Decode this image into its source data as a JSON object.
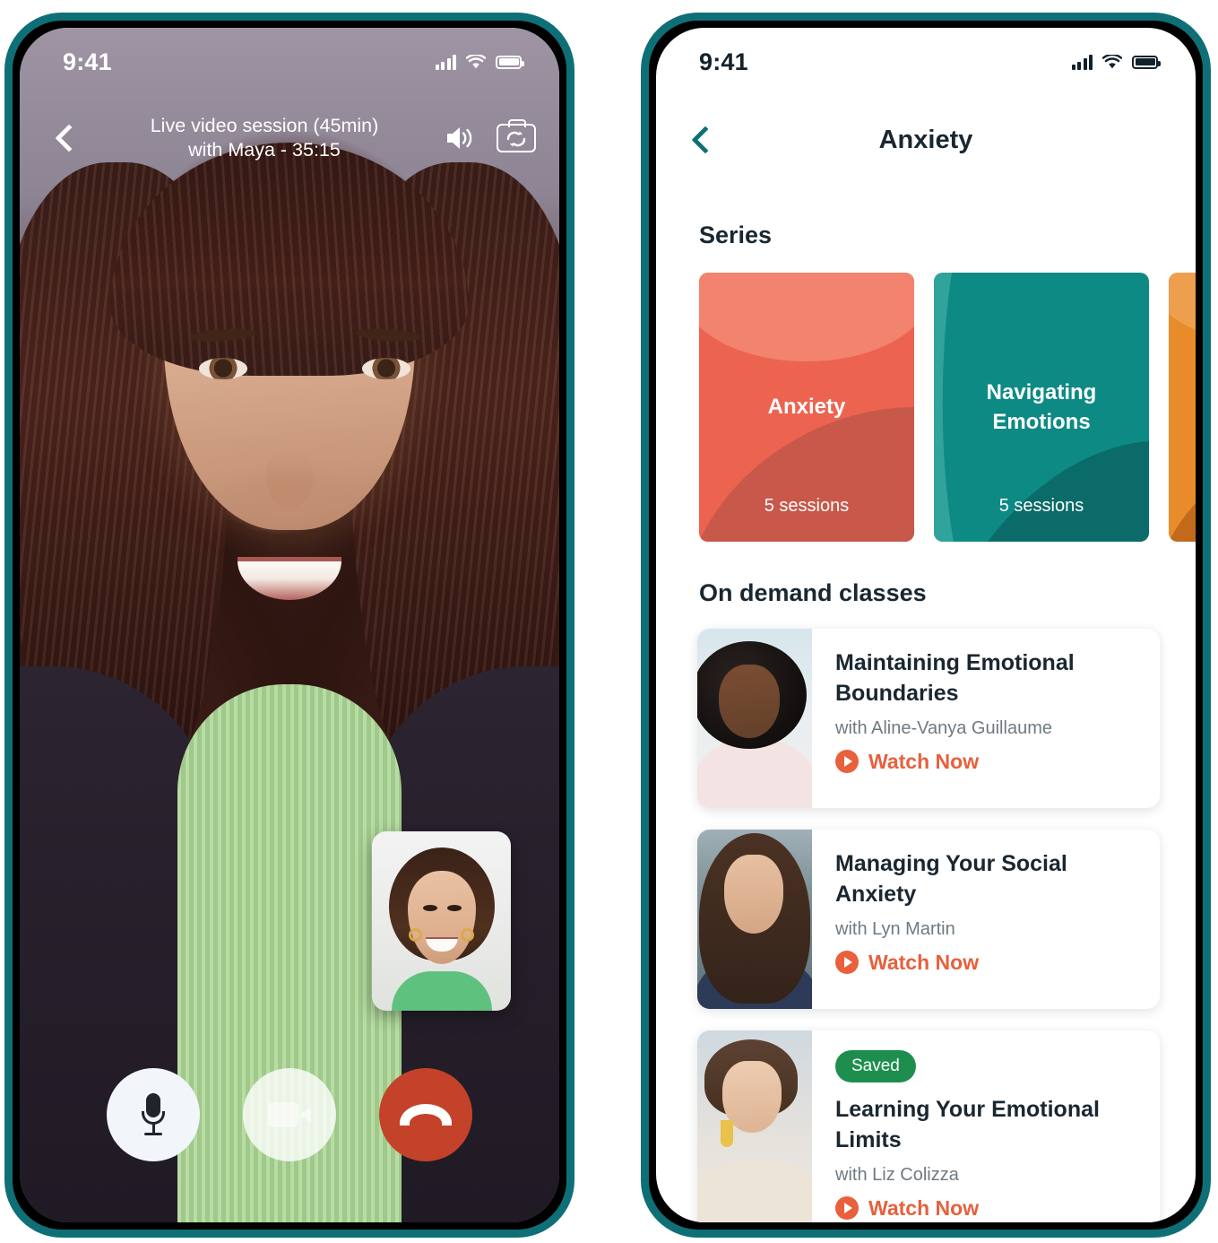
{
  "theme": {
    "frame_teal": "#0E7076",
    "coral": "#EC6450",
    "teal": "#0E8A84",
    "orange": "#E88B2A",
    "watch_orange": "#E8603C",
    "saved_green": "#1E8E4E",
    "end_call_red": "#C4422A",
    "text_dark": "#1A2730",
    "text_muted": "#6D7A82"
  },
  "left_phone": {
    "status_bar": {
      "time": "9:41",
      "icons": [
        "signal-icon",
        "wifi-icon",
        "battery-icon"
      ]
    },
    "header": {
      "back_icon": "chevron-left-icon",
      "title_line1": "Live video session (45min)",
      "title_line2": "with Maya - 35:15",
      "speaker_icon": "speaker-on-icon",
      "flip_camera_icon": "flip-camera-icon"
    },
    "pip": {
      "label": "self-view-thumbnail"
    },
    "controls": [
      {
        "name": "microphone-button",
        "icon": "microphone-icon"
      },
      {
        "name": "camera-button",
        "icon": "video-camera-icon"
      },
      {
        "name": "end-call-button",
        "icon": "phone-hangup-icon"
      }
    ]
  },
  "right_phone": {
    "status_bar": {
      "time": "9:41",
      "icons": [
        "signal-icon",
        "wifi-icon",
        "battery-icon"
      ]
    },
    "nav": {
      "back_icon": "chevron-left-icon",
      "title": "Anxiety"
    },
    "sections": {
      "series_title": "Series",
      "on_demand_title": "On demand classes"
    },
    "series": [
      {
        "name": "Anxiety",
        "sessions": "5 sessions",
        "color": "#EC6450"
      },
      {
        "name": "Navigating Emotions",
        "sessions": "5 sessions",
        "color": "#0E8A84"
      },
      {
        "name": "",
        "sessions": "",
        "color": "#E88B2A"
      }
    ],
    "classes": [
      {
        "badge": null,
        "title": "Maintaining Emotional Boundaries",
        "author": "with Aline-Vanya Guillaume",
        "cta": "Watch Now",
        "cta_icon": "play-circle-icon",
        "thumbnail": "instructor-photo-1"
      },
      {
        "badge": null,
        "title": "Managing Your Social Anxiety",
        "author": "with Lyn Martin",
        "cta": "Watch Now",
        "cta_icon": "play-circle-icon",
        "thumbnail": "instructor-photo-2"
      },
      {
        "badge": "Saved",
        "title": "Learning Your Emotional Limits",
        "author": "with Liz Colizza",
        "cta": "Watch Now",
        "cta_icon": "play-circle-icon",
        "thumbnail": "instructor-photo-3"
      }
    ]
  }
}
